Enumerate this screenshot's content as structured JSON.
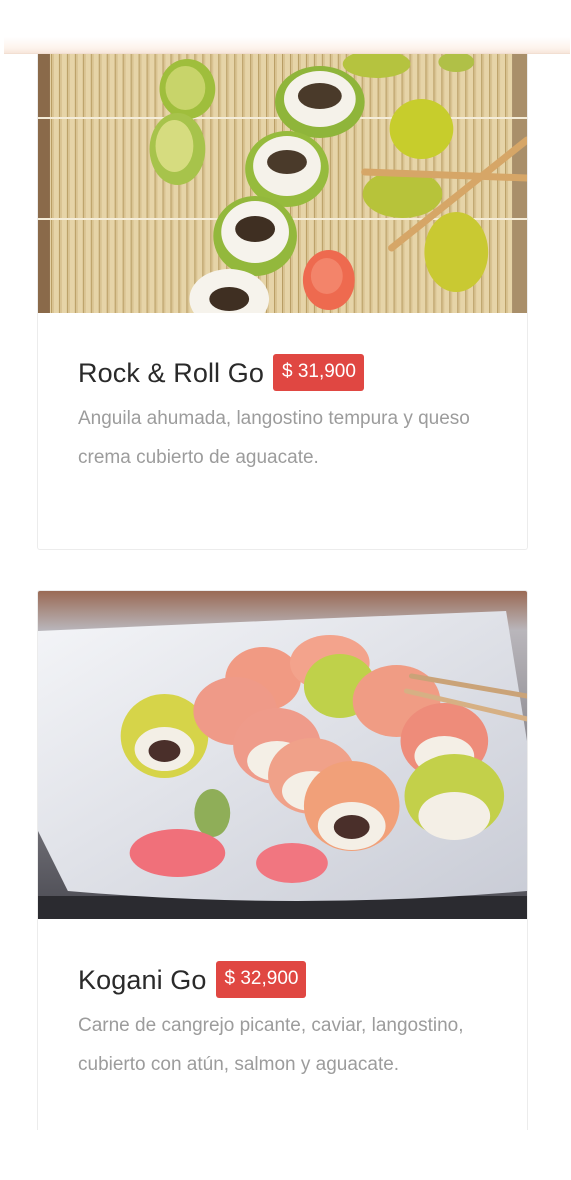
{
  "menu_items": [
    {
      "name": "Rock & Roll Go",
      "price": "$ 31,900",
      "description": "Anguila ahumada, langostino tempura y queso crema cubierto de aguacate."
    },
    {
      "name": "Kogani Go",
      "price": "$ 32,900",
      "description": "Carne de cangrejo picante, caviar, langostino, cubierto con atún, salmon y aguacate."
    }
  ],
  "colors": {
    "price_badge": "#e04742",
    "title_text": "#2a2a2a",
    "description_text": "#9c9c9c"
  }
}
